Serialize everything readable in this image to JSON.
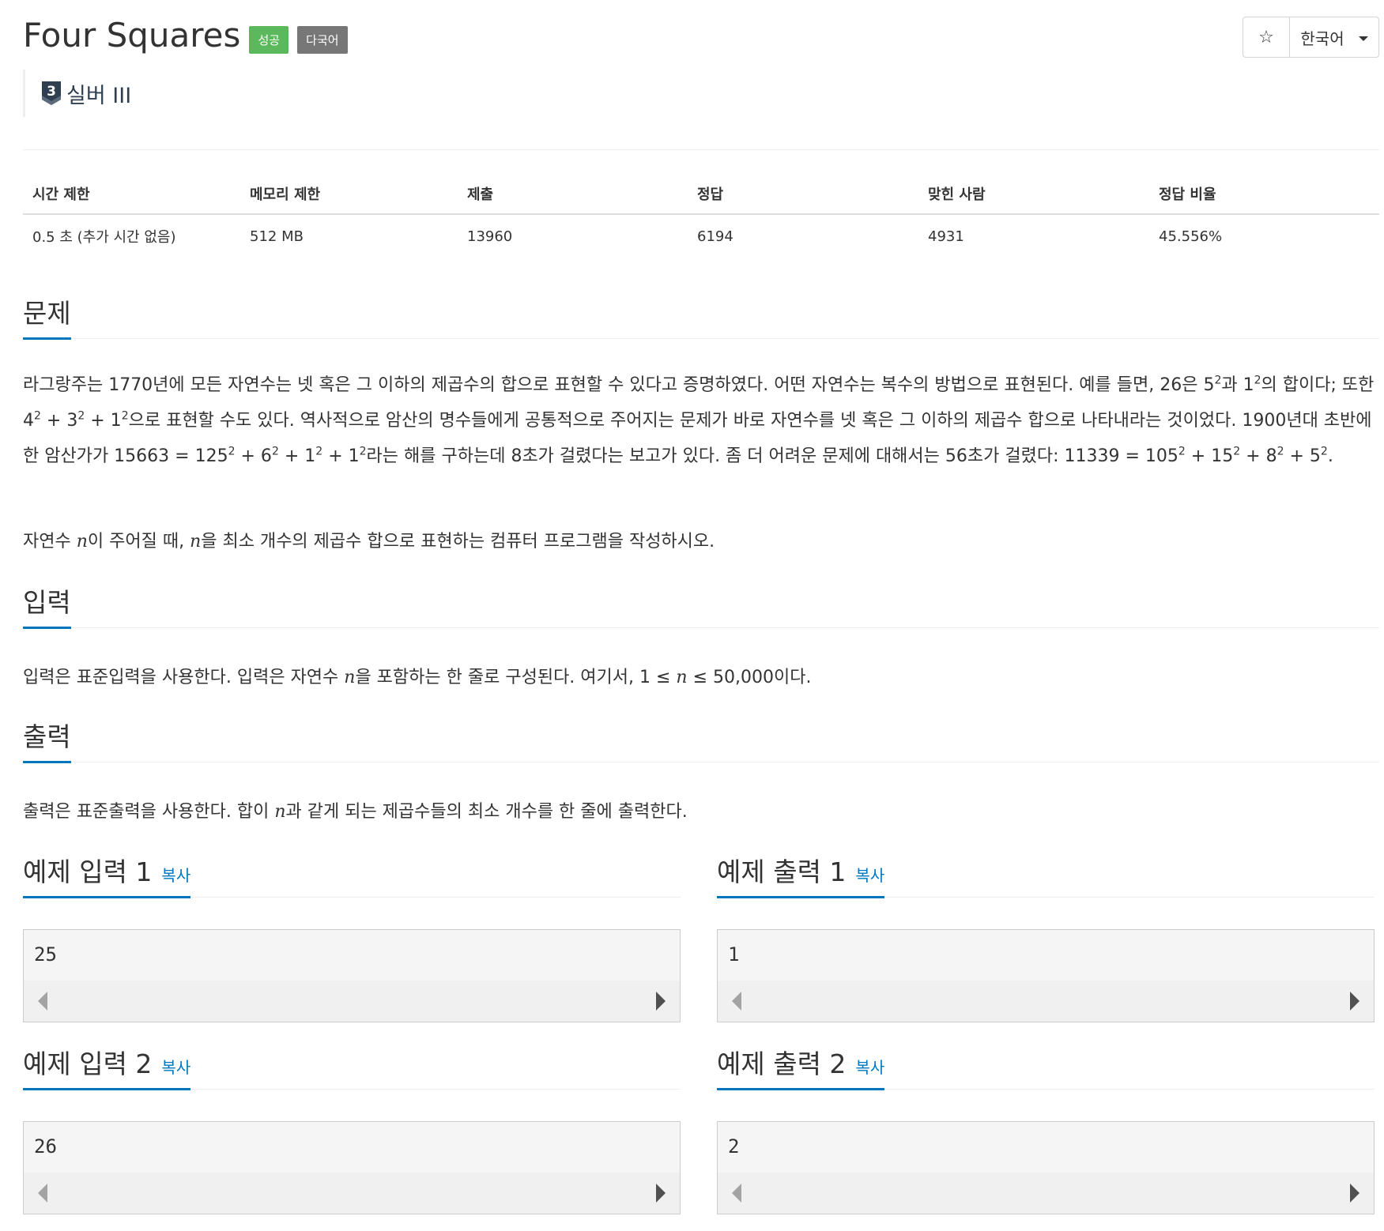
{
  "header": {
    "title": "Four Squares",
    "badge_success": "성공",
    "badge_multilang": "다국어",
    "favorite_icon": "☆",
    "language": "한국어",
    "tier_number": "3",
    "tier_label": "실버 III"
  },
  "info_table": {
    "headers": [
      "시간 제한",
      "메모리 제한",
      "제출",
      "정답",
      "맞힌 사람",
      "정답 비율"
    ],
    "values": [
      "0.5 초 (추가 시간 없음)",
      "512 MB",
      "13960",
      "6194",
      "4931",
      "45.556%"
    ]
  },
  "problem": {
    "heading": "문제",
    "p1": {
      "t1": "라그랑주는 1770년에 모든 자연수는 넷 혹은 그 이하의 제곱수의 합으로 표현할 수 있다고 증명하였다. 어떤 자연수는 복수의 방법으로 표현된다. 예를 들면, 26은 5",
      "t2": "과 1",
      "t3": "의 합이다; 또한 4",
      "t4": " + 3",
      "t5": " + 1",
      "t6": "으로 표현할 수도 있다. 역사적으로 암산의 명수들에게 공통적으로 주어지는 문제가 바로 자연수를 넷 혹은 그 이하의 제곱수 합으로 나타내라는 것이었다. 1900년대 초반에 한 암산가가 15663 = 125",
      "t7": " + 6",
      "t8": " + 1",
      "t9": " + 1",
      "t10": "라는 해를 구하는데 8초가 걸렸다는 보고가 있다. 좀 더 어려운 문제에 대해서는 56초가 걸렸다: 11339 = 105",
      "t11": " + 15",
      "t12": " + 8",
      "t13": " + 5",
      "t14": ".",
      "exp": "2"
    },
    "p2": {
      "t1": "자연수 ",
      "var": "n",
      "t2": "이 주어질 때, ",
      "t3": "을 최소 개수의 제곱수 합으로 표현하는 컴퓨터 프로그램을 작성하시오."
    }
  },
  "input": {
    "heading": "입력",
    "t1": "입력은 표준입력을 사용한다. 입력은 자연수 ",
    "var": "n",
    "t2": "을 포함하는 한 줄로 구성된다. 여기서, 1 ≤ ",
    "t3": " ≤ 50,000이다."
  },
  "output": {
    "heading": "출력",
    "t1": "출력은 표준출력을 사용한다. 합이 ",
    "var": "n",
    "t2": "과 같게 되는 제곱수들의 최소 개수를 한 줄에 출력한다."
  },
  "samples": {
    "copy_label": "복사",
    "input1_title": "예제 입력 1",
    "input1_value": "25",
    "output1_title": "예제 출력 1",
    "output1_value": "1",
    "input2_title": "예제 입력 2",
    "input2_value": "26",
    "output2_title": "예제 출력 2",
    "output2_value": "2"
  },
  "colors": {
    "accent": "#0076c0",
    "success": "#5cb85c",
    "default_badge": "#777777"
  }
}
